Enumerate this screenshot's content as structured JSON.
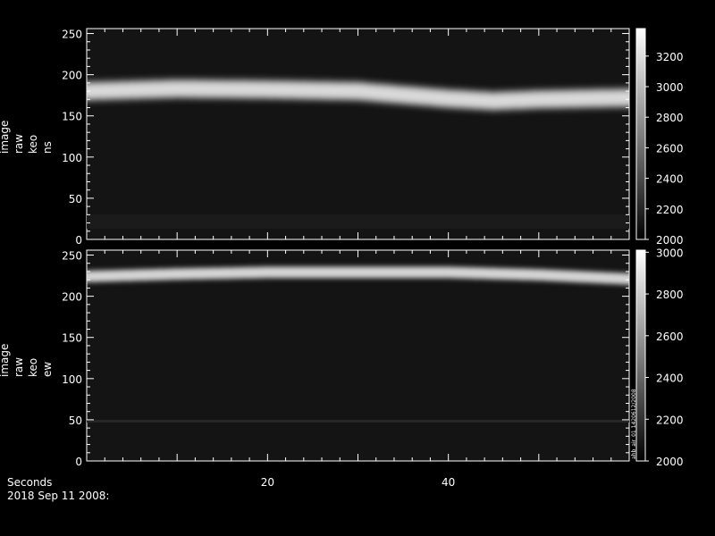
{
  "chart_data": [
    {
      "type": "heatmap",
      "title": "",
      "ylabel_lines": [
        "image",
        "raw",
        "keo",
        "ns"
      ],
      "xlim": [
        0,
        60
      ],
      "ylim": [
        0,
        256
      ],
      "yticks": [
        0,
        50,
        100,
        150,
        200,
        250
      ],
      "colorbar": {
        "min": 2000,
        "max": 3380,
        "ticks": [
          2000,
          2200,
          2400,
          2600,
          2800,
          3000,
          3200
        ]
      },
      "band": {
        "description_points_x": [
          0,
          10,
          20,
          30,
          40,
          45,
          50,
          60
        ],
        "center_y": [
          180,
          183,
          182,
          180,
          171,
          168,
          170,
          172
        ],
        "width": 22
      },
      "background_level": 2050,
      "peak_level": 3100
    },
    {
      "type": "heatmap",
      "title": "",
      "ylabel_lines": [
        "image",
        "raw",
        "keo",
        "ew"
      ],
      "xlim": [
        0,
        60
      ],
      "ylim": [
        0,
        256
      ],
      "yticks": [
        0,
        50,
        100,
        150,
        200,
        250
      ],
      "colorbar": {
        "min": 2000,
        "max": 3010,
        "ticks": [
          2000,
          2200,
          2400,
          2600,
          2800,
          3000
        ]
      },
      "band": {
        "description_points_x": [
          0,
          10,
          20,
          30,
          40,
          50,
          60
        ],
        "center_y": [
          224,
          227,
          229,
          229,
          229,
          226,
          221
        ],
        "width": 14
      },
      "background_level": 2030,
      "peak_level": 2900,
      "side_annotation": "ahb_air_01  1420612/2008"
    }
  ],
  "x_axis": {
    "label": "Seconds",
    "ticks": [
      20,
      40
    ]
  },
  "date_label": "2018 Sep 11 2008:"
}
